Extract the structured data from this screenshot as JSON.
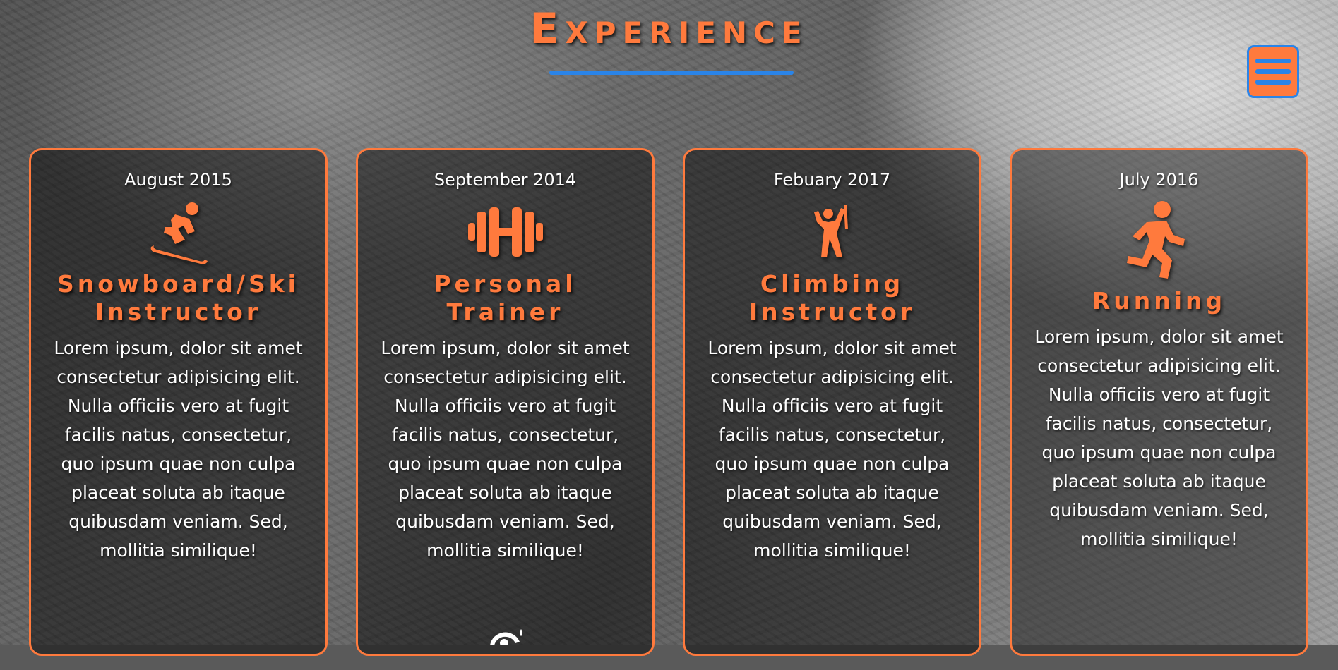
{
  "section": {
    "title": "Experience"
  },
  "menu": {
    "icon": "hamburger-menu-icon",
    "accent": "#ff7a3d",
    "border": "#2a84e8"
  },
  "cards": [
    {
      "date": "August 2015",
      "icon": "snowboarder-icon",
      "title": "Snowboard/Ski Instructor",
      "text": "Lorem ipsum, dolor sit amet consectetur adipisicing elit. Nulla officiis vero at fugit facilis natus, consectetur, quo ipsum quae non culpa placeat soluta ab itaque quibusdam veniam. Sed, mollitia similique!"
    },
    {
      "date": "September 2014",
      "icon": "dumbbell-icon",
      "title": "Personal Trainer",
      "text": "Lorem ipsum, dolor sit amet consectetur adipisicing elit. Nulla officiis vero at fugit facilis natus, consectetur, quo ipsum quae non culpa placeat soluta ab itaque quibusdam veniam. Sed, mollitia similique!"
    },
    {
      "date": "Febuary 2017",
      "icon": "climber-icon",
      "title": "Climbing Instructor",
      "text": "Lorem ipsum, dolor sit amet consectetur adipisicing elit. Nulla officiis vero at fugit facilis natus, consectetur, quo ipsum quae non culpa placeat soluta ab itaque quibusdam veniam. Sed, mollitia similique!"
    },
    {
      "date": "July 2016",
      "icon": "running-icon",
      "title": "Running",
      "text": "Lorem ipsum, dolor sit amet consectetur adipisicing elit. Nulla officiis vero at fugit facilis natus, consectetur, quo ipsum quae non culpa placeat soluta ab itaque quibusdam veniam. Sed, mollitia similique!"
    }
  ],
  "colors": {
    "accent": "#ff7a3d",
    "underline": "#2a84e8"
  }
}
